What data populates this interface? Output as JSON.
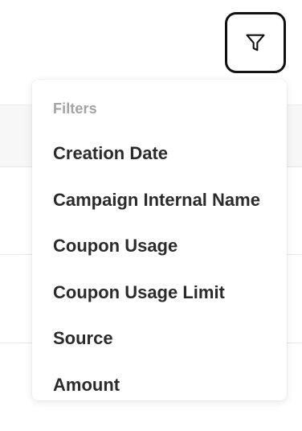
{
  "filter_button": {
    "icon": "filter-funnel-icon"
  },
  "dropdown": {
    "heading": "Filters",
    "items": [
      {
        "label": "Creation Date"
      },
      {
        "label": "Campaign Internal Name"
      },
      {
        "label": "Coupon Usage"
      },
      {
        "label": "Coupon Usage Limit"
      },
      {
        "label": "Source"
      },
      {
        "label": "Amount"
      }
    ]
  }
}
